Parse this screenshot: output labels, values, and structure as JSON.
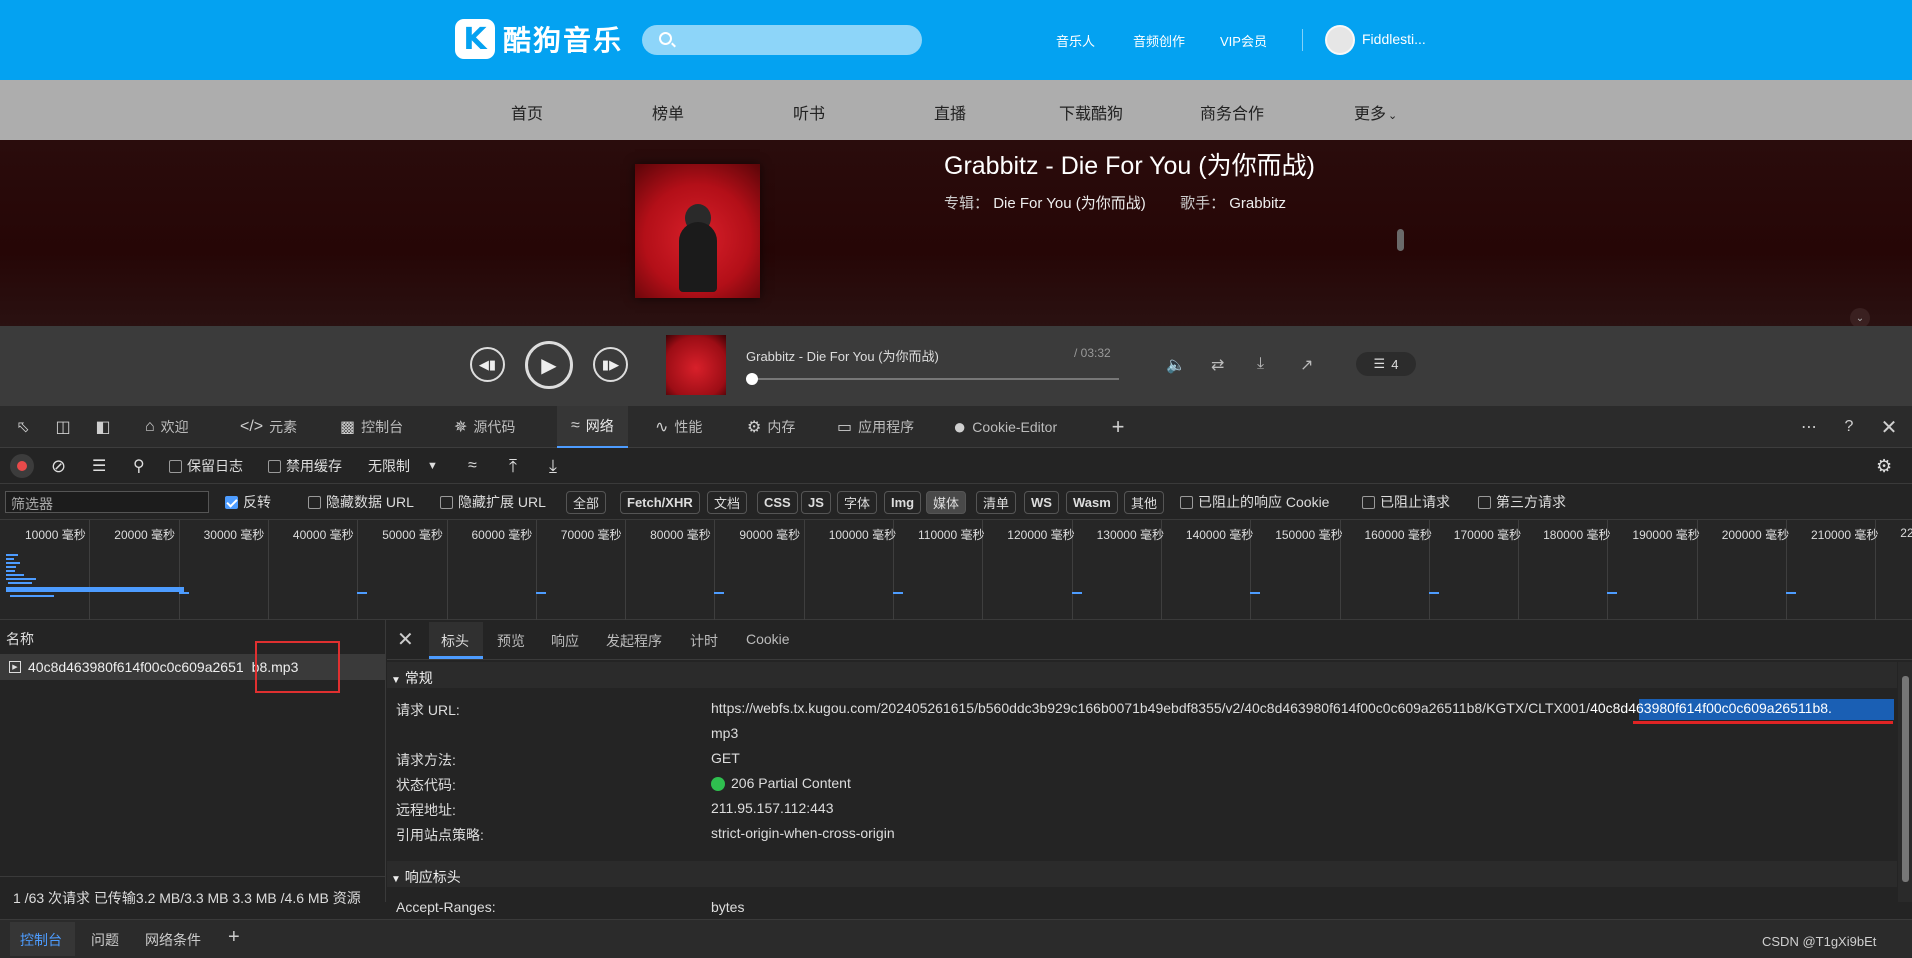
{
  "kugou": {
    "logo_letter": "K",
    "logo_text": "酷狗音乐",
    "top_links": [
      "音乐人",
      "音频创作",
      "VIP会员"
    ],
    "username": "Fiddlesti...",
    "nav": [
      "首页",
      "榜单",
      "听书",
      "直播",
      "下载酷狗",
      "商务合作",
      "更多"
    ],
    "song_title": "Grabbitz - Die For You (为你而战)",
    "album_label": "专辑：",
    "album": "Die For You (为你而战)",
    "artist_label": "歌手：",
    "artist": "Grabbitz",
    "player": {
      "now_playing": "Grabbitz - Die For You (为你而战)",
      "time": "/ 03:32",
      "queue_count": "4",
      "progress": 0
    }
  },
  "devtools": {
    "tabs": [
      "欢迎",
      "元素",
      "控制台",
      "源代码",
      "网络",
      "性能",
      "内存",
      "应用程序",
      "Cookie-Editor"
    ],
    "active_tab": "网络",
    "toolbar": {
      "preserve_log": "保留日志",
      "disable_cache": "禁用缓存",
      "throttle": "无限制"
    },
    "filter": {
      "placeholder": "筛选器",
      "invert": "反转",
      "hide_data_url": "隐藏数据 URL",
      "hide_ext_url": "隐藏扩展 URL",
      "types": [
        "全部",
        "Fetch/XHR",
        "文档",
        "CSS",
        "JS",
        "字体",
        "Img",
        "媒体",
        "清单",
        "WS",
        "Wasm",
        "其他"
      ],
      "selected_type": "媒体",
      "blocked_cookies": "已阻止的响应 Cookie",
      "blocked_requests": "已阻止请求",
      "third_party": "第三方请求"
    },
    "timeline_labels": [
      "10000 毫秒",
      "20000 毫秒",
      "30000 毫秒",
      "40000 毫秒",
      "50000 毫秒",
      "60000 毫秒",
      "70000 毫秒",
      "80000 毫秒",
      "90000 毫秒",
      "100000 毫秒",
      "110000 毫秒",
      "120000 毫秒",
      "130000 毫秒",
      "140000 毫秒",
      "150000 毫秒",
      "160000 毫秒",
      "170000 毫秒",
      "180000 毫秒",
      "190000 毫秒",
      "200000 毫秒",
      "210000 毫秒",
      "22"
    ],
    "requests": {
      "column_name": "名称",
      "row_name": "40c8d463980f614f00c0c609a26511b8.mp3",
      "row_name_prefix": "40c8d463980f614f00c0c609a2651",
      "row_name_suffix": "b8.mp3",
      "status": "1 /63 次请求  已传输3.2 MB/3.3 MB  3.3 MB /4.6 MB 资源"
    },
    "detail_tabs": [
      "标头",
      "预览",
      "响应",
      "发起程序",
      "计时",
      "Cookie"
    ],
    "general": {
      "title": "常规",
      "url_label": "请求 URL:",
      "url_main": "https://webfs.tx.kugou.com/202405261615/b560ddc3b929c166b0071b49ebdf8355/v2/40c8d463980f614f00c0c609a26511b8/KGTX/CLTX001/",
      "url_highlight": "40c8d463980f614f00c0c609a26511b8.",
      "url_tail": "mp3",
      "method_label": "请求方法:",
      "method": "GET",
      "status_label": "状态代码:",
      "status": "206 Partial Content",
      "remote_label": "远程地址:",
      "remote": "211.95.157.112:443",
      "referrer_label": "引用站点策略:",
      "referrer": "strict-origin-when-cross-origin"
    },
    "response_headers": {
      "title": "响应标头",
      "accept_ranges_label": "Accept-Ranges:",
      "accept_ranges": "bytes"
    },
    "drawer_tabs": [
      "控制台",
      "问题",
      "网络条件"
    ],
    "watermark": "CSDN @T1gXi9bEt"
  }
}
